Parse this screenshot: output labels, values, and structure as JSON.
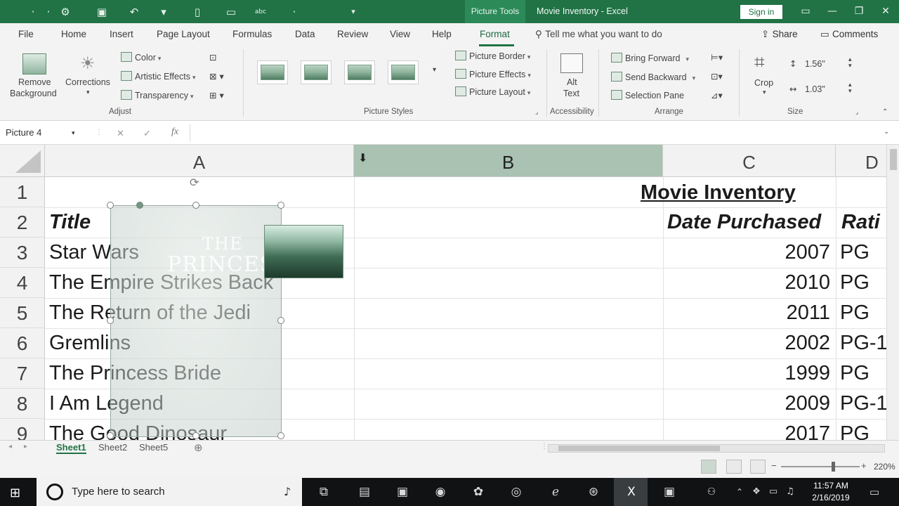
{
  "titlebar": {
    "context_tab": "Picture Tools",
    "document_title": "Movie Inventory - Excel",
    "sign_in": "Sign in",
    "colors": {
      "brand": "#217346"
    }
  },
  "menu": {
    "tabs": [
      "File",
      "Home",
      "Insert",
      "Page Layout",
      "Formulas",
      "Data",
      "Review",
      "View",
      "Help",
      "Format"
    ],
    "active_tab": "Format",
    "tell_me": "Tell me what you want to do",
    "share": "Share",
    "comments": "Comments"
  },
  "ribbon": {
    "adjust": {
      "label": "Adjust",
      "remove_background": [
        "Remove",
        "Background"
      ],
      "corrections": "Corrections",
      "color": "Color",
      "artistic_effects": "Artistic Effects",
      "transparency": "Transparency"
    },
    "picture_styles": {
      "label": "Picture Styles",
      "picture_border": "Picture Border",
      "picture_effects": "Picture Effects",
      "picture_layout": "Picture Layout"
    },
    "accessibility": {
      "label": "Accessibility",
      "alt_text": [
        "Alt",
        "Text"
      ]
    },
    "arrange": {
      "label": "Arrange",
      "bring_forward": "Bring Forward",
      "send_backward": "Send Backward",
      "selection_pane": "Selection Pane"
    },
    "size": {
      "label": "Size",
      "crop": "Crop",
      "height": "1.56\"",
      "width": "1.03\""
    }
  },
  "formula_bar": {
    "name_box": "Picture 4",
    "fx": "fx",
    "cancel": "✕",
    "enter": "✓"
  },
  "sheet": {
    "columns": [
      "A",
      "B",
      "C",
      "D"
    ],
    "selected_column": "B",
    "rows": [
      "1",
      "2",
      "3",
      "4",
      "5",
      "6",
      "7",
      "8",
      "9"
    ],
    "title_cell": "Movie Inventory",
    "headers": {
      "title": "Title",
      "date_purchased": "Date Purchased",
      "rating": "Rati"
    },
    "records": [
      {
        "title": "Star Wars",
        "year": "2007",
        "rating": "PG"
      },
      {
        "title": "The Empire Strikes Back",
        "year": "2010",
        "rating": "PG"
      },
      {
        "title": "The Return of the Jedi",
        "year": "2011",
        "rating": "PG"
      },
      {
        "title": "Gremlins",
        "year": "2002",
        "rating": "PG-1"
      },
      {
        "title": "The Princess Bride",
        "year": "1999",
        "rating": "PG"
      },
      {
        "title": "I Am Legend",
        "year": "2009",
        "rating": "PG-1"
      },
      {
        "title": "The Good Dinosaur",
        "year": "2017",
        "rating": "PG"
      }
    ],
    "picture_text": [
      "THE",
      "PRINCESS"
    ]
  },
  "sheet_tabs": [
    "Sheet1",
    "Sheet2",
    "Sheet5"
  ],
  "active_sheet": "Sheet1",
  "status": {
    "zoom": "220%"
  },
  "taskbar": {
    "search_placeholder": "Type here to search",
    "time": "11:57 AM",
    "date": "2/16/2019"
  }
}
